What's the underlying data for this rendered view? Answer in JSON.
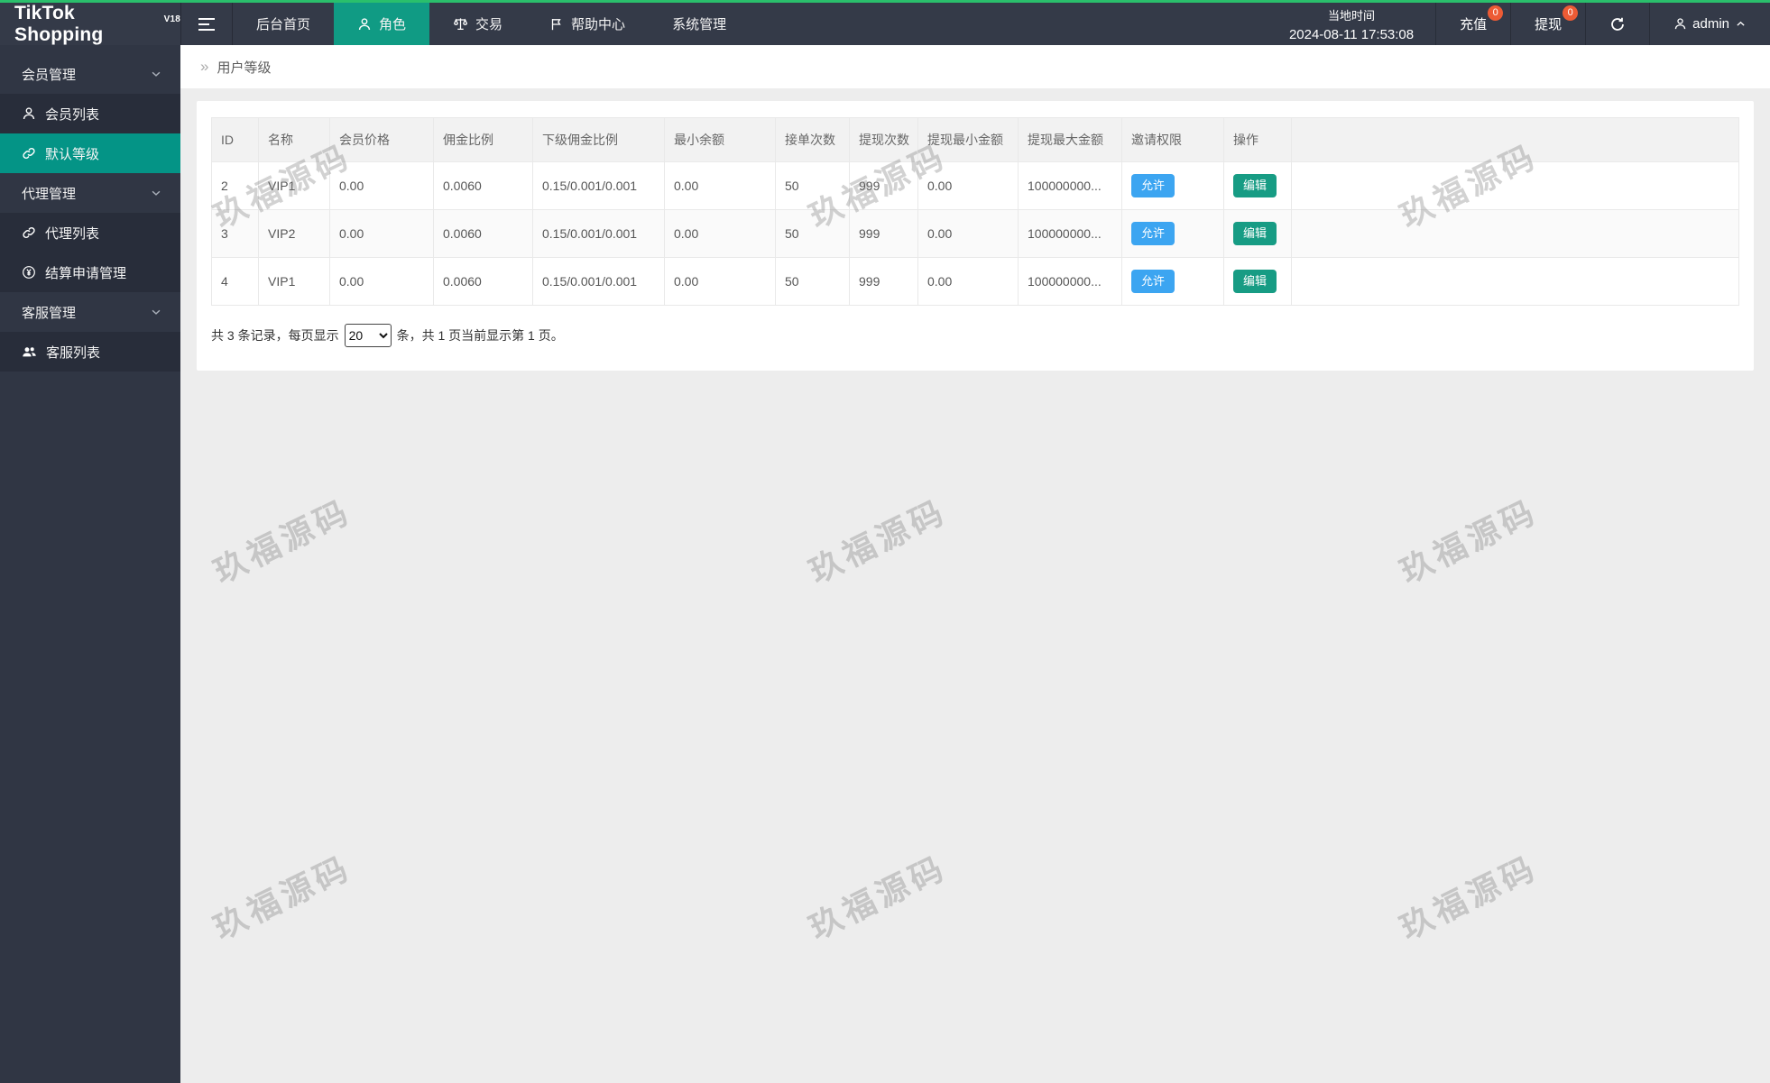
{
  "colors": {
    "accent": "#109b84",
    "sidebar-active": "#049486",
    "blue": "#3ca5f1",
    "green": "#179c84",
    "badge": "#ed5b35",
    "topline": "#2abf6c"
  },
  "logo": {
    "text": "TikTok Shopping",
    "version": "V18"
  },
  "topnav": {
    "items": [
      {
        "label": "后台首页"
      },
      {
        "label": "角色"
      },
      {
        "label": "交易"
      },
      {
        "label": "帮助中心"
      },
      {
        "label": "系统管理"
      }
    ]
  },
  "header_right": {
    "time_label": "当地时间",
    "time_value": "2024-08-11 17:53:08",
    "recharge": {
      "label": "充值",
      "badge": "0"
    },
    "withdraw": {
      "label": "提现",
      "badge": "0"
    },
    "user": {
      "name": "admin"
    }
  },
  "sidebar": {
    "groups": [
      {
        "label": "会员管理",
        "items": [
          {
            "label": "会员列表"
          },
          {
            "label": "默认等级"
          }
        ]
      },
      {
        "label": "代理管理",
        "items": [
          {
            "label": "代理列表"
          },
          {
            "label": "结算申请管理"
          }
        ]
      },
      {
        "label": "客服管理",
        "items": [
          {
            "label": "客服列表"
          }
        ]
      }
    ]
  },
  "breadcrumb": {
    "arrow": "»",
    "title": "用户等级"
  },
  "table": {
    "columns": [
      "ID",
      "名称",
      "会员价格",
      "佣金比例",
      "下级佣金比例",
      "最小余额",
      "接单次数",
      "提现次数",
      "提现最小金额",
      "提现最大金额",
      "邀请权限",
      "操作"
    ],
    "rows": [
      {
        "id": "2",
        "name": "VIP1",
        "price": "0.00",
        "rate": "0.0060",
        "sub_rate": "0.15/0.001/0.001",
        "min_balance": "0.00",
        "order_count": "50",
        "withdraw_count": "999",
        "withdraw_min": "0.00",
        "withdraw_max": "100000000...",
        "invite": "允许",
        "action": "编辑"
      },
      {
        "id": "3",
        "name": "VIP2",
        "price": "0.00",
        "rate": "0.0060",
        "sub_rate": "0.15/0.001/0.001",
        "min_balance": "0.00",
        "order_count": "50",
        "withdraw_count": "999",
        "withdraw_min": "0.00",
        "withdraw_max": "100000000...",
        "invite": "允许",
        "action": "编辑"
      },
      {
        "id": "4",
        "name": "VIP1",
        "price": "0.00",
        "rate": "0.0060",
        "sub_rate": "0.15/0.001/0.001",
        "min_balance": "0.00",
        "order_count": "50",
        "withdraw_count": "999",
        "withdraw_min": "0.00",
        "withdraw_max": "100000000...",
        "invite": "允许",
        "action": "编辑"
      }
    ]
  },
  "pagination": {
    "prefix": "共 3 条记录，每页显示",
    "page_size": "20",
    "suffix": "条，共 1 页当前显示第 1 页。"
  },
  "watermark": {
    "text": "玖福源码"
  }
}
